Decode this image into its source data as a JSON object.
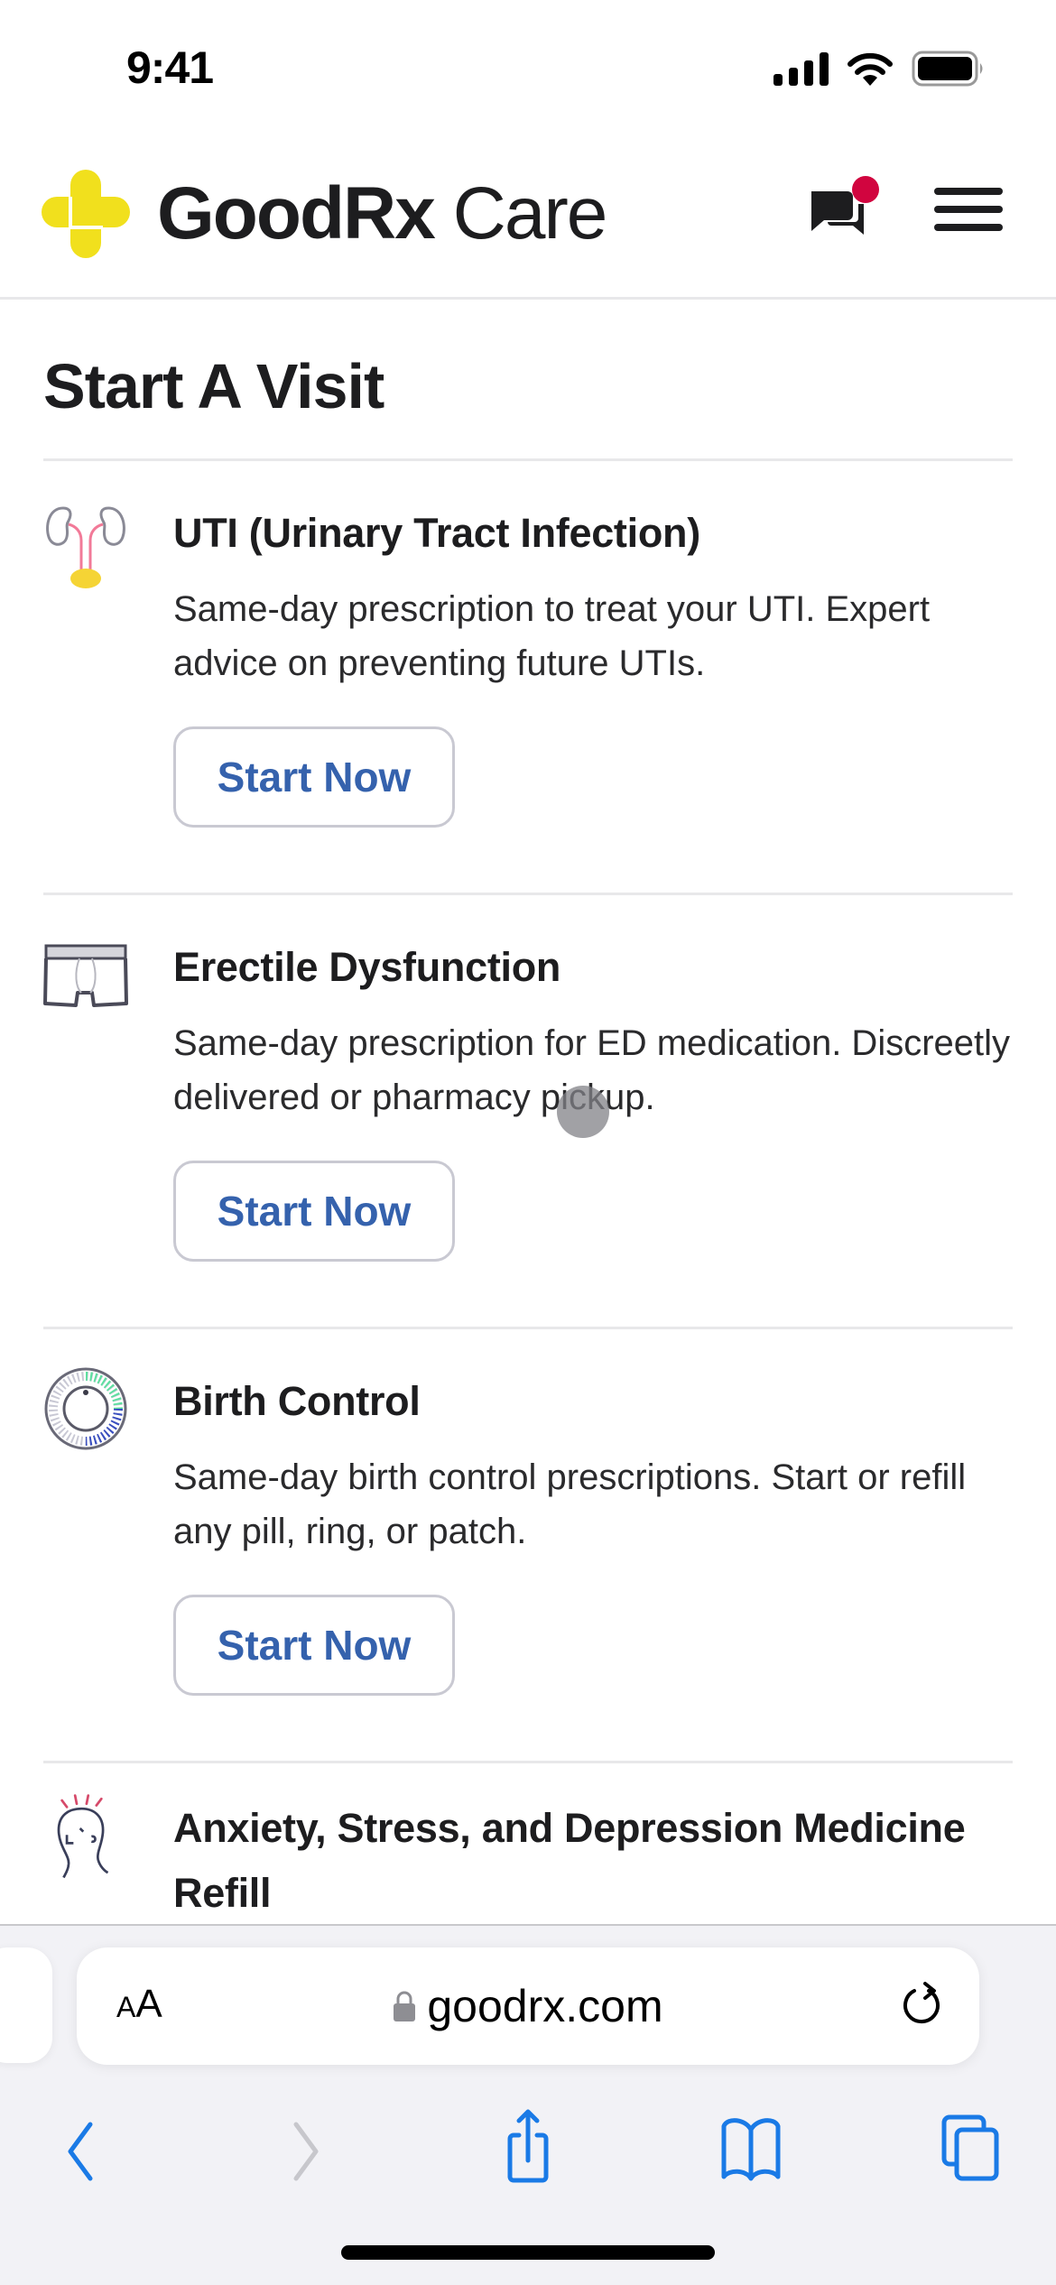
{
  "status_bar": {
    "time": "9:41"
  },
  "header": {
    "brand_bold": "GoodRx",
    "brand_light": " Care",
    "brand_color": "#f1e01d",
    "notification_color": "#d1053f"
  },
  "main": {
    "title": "Start A Visit",
    "visits": [
      {
        "icon": "kidneys-icon",
        "title": "UTI (Urinary Tract Infection)",
        "description": "Same-day prescription to treat your UTI. Expert advice on preventing future UTIs.",
        "button_label": "Start Now"
      },
      {
        "icon": "underwear-icon",
        "title": "Erectile Dysfunction",
        "description": "Same-day prescription for ED medication. Discreetly delivered or pharmacy pickup.",
        "button_label": "Start Now"
      },
      {
        "icon": "pill-dial-icon",
        "title": "Birth Control",
        "description": "Same-day birth control prescriptions. Start or refill any pill, ring, or patch.",
        "button_label": "Start Now"
      },
      {
        "icon": "stressed-head-icon",
        "title": "Anxiety, Stress, and Depression Medicine Refill"
      }
    ],
    "button_color": "#3562ad"
  },
  "browser": {
    "text_size_label_small": "A",
    "text_size_label_large": "A",
    "url": "goodrx.com",
    "accent_color": "#1a7ae6"
  }
}
